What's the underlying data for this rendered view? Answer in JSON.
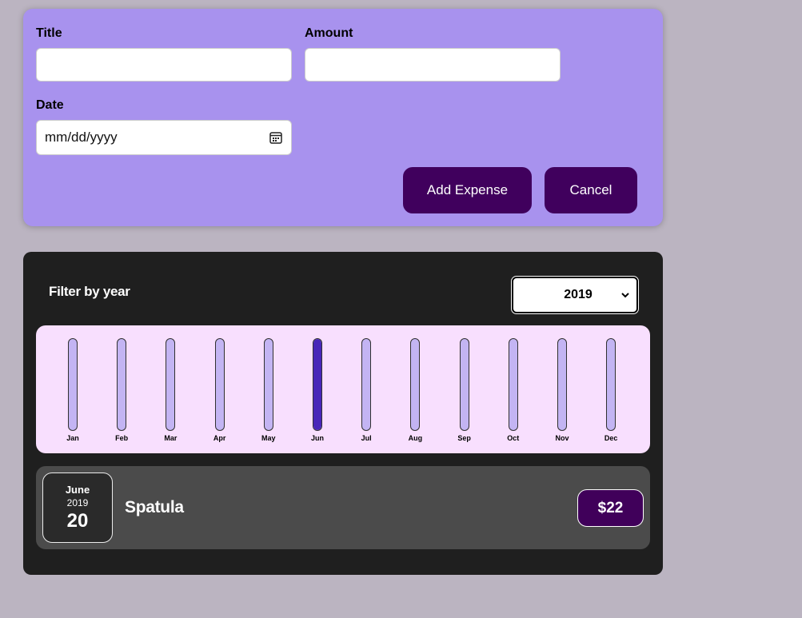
{
  "form": {
    "title_label": "Title",
    "amount_label": "Amount",
    "date_label": "Date",
    "title_value": "",
    "amount_value": "",
    "date_placeholder": "mm/dd/yyyy",
    "add_button": "Add Expense",
    "cancel_button": "Cancel"
  },
  "filter": {
    "label": "Filter by year",
    "selected_year": "2019"
  },
  "chart_data": {
    "type": "bar",
    "categories": [
      "Jan",
      "Feb",
      "Mar",
      "Apr",
      "May",
      "Jun",
      "Jul",
      "Aug",
      "Sep",
      "Oct",
      "Nov",
      "Dec"
    ],
    "values": [
      0,
      0,
      0,
      0,
      0,
      22,
      0,
      0,
      0,
      0,
      0,
      0
    ],
    "ylim": [
      0,
      22
    ]
  },
  "expenses": [
    {
      "month": "June",
      "year": "2019",
      "day": "20",
      "title": "Spatula",
      "amount": "$22"
    }
  ],
  "colors": {
    "form_bg": "#a892ee",
    "button_bg": "#40005d",
    "chart_bg": "#f8dffe",
    "bar_track": "#c3b4f3",
    "bar_fill": "#4826b9"
  },
  "icons": {
    "date_field": "calendar-icon",
    "year_select": "chevron-down-icon"
  }
}
